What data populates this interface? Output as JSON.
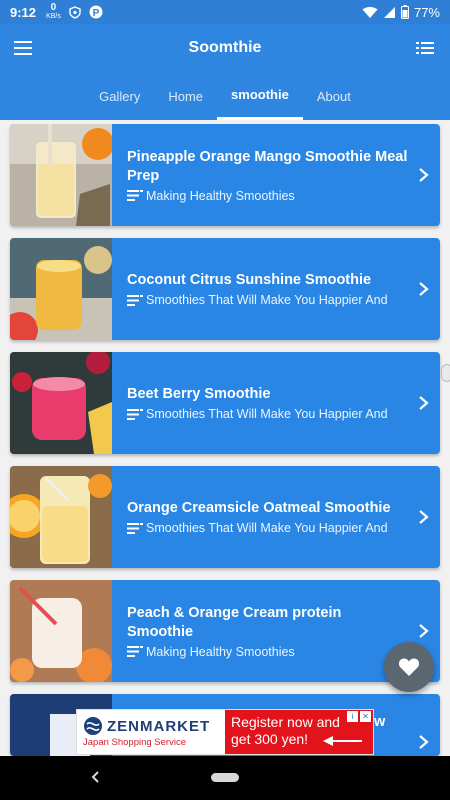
{
  "status": {
    "time": "9:12",
    "speed_value": "0",
    "speed_unit": "KB/s",
    "battery": "77%"
  },
  "app": {
    "title": "Soomthie",
    "accent": "#2f86e0"
  },
  "tabs": [
    {
      "label": "Gallery",
      "active": false
    },
    {
      "label": "Home",
      "active": false
    },
    {
      "label": "smoothie",
      "active": true
    },
    {
      "label": "About",
      "active": false
    }
  ],
  "cards": [
    {
      "title": "Pineapple Orange Mango Smoothie Meal Prep",
      "subtitle": "Making Healthy Smoothies"
    },
    {
      "title": "Coconut Citrus Sunshine Smoothie",
      "subtitle": "Smoothies That Will Make You Happier And"
    },
    {
      "title": "Beet Berry Smoothie",
      "subtitle": "Smoothies That Will Make You Happier And"
    },
    {
      "title": "Orange Creamsicle Oatmeal Smoothie",
      "subtitle": "Smoothies That Will Make You Happier And"
    },
    {
      "title": "Peach & Orange Cream protein Smoothie",
      "subtitle": "Making Healthy Smoothies"
    },
    {
      "title": "",
      "subtitle": ""
    }
  ],
  "ad": {
    "brand": "ZENMARKET",
    "tagline": "Japan Shopping Service",
    "line1": "Register now and",
    "line2": "get 300 yen!",
    "peek_text": "w"
  },
  "icons": {
    "menu": "menu-icon",
    "list": "list-view-icon",
    "favorite": "heart-icon",
    "chevron": "chevron-right-icon"
  }
}
